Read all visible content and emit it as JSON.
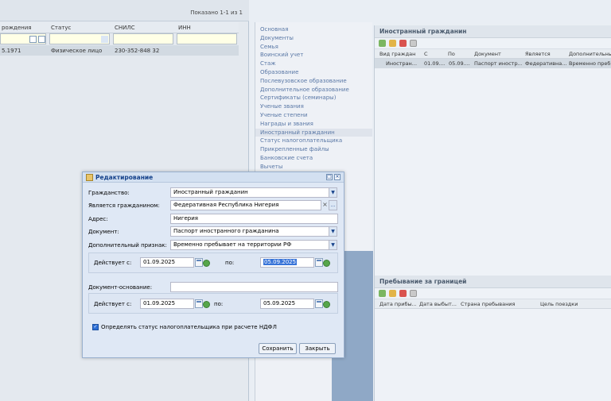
{
  "left_grid": {
    "paging": "Показано 1-1 из 1",
    "columns": [
      "рождения",
      "Статус",
      "СНИЛС",
      "ИНН"
    ],
    "row": [
      "5.1971",
      "Физическое лицо",
      "230-352-848 32",
      ""
    ]
  },
  "nav": {
    "items": [
      "Основная",
      "Документы",
      "Семья",
      "Воинский учет",
      "Стаж",
      "Образование",
      "Послевузовское образование",
      "Дополнительное образование",
      "Сертификаты (семинары)",
      "Ученые звания",
      "Ученые степени",
      "Награды и звания",
      "Иностранный гражданин",
      "Статус налогоплательщика",
      "Прикрепленные файлы",
      "Банковские счета",
      "Вычеты"
    ]
  },
  "foreign_panel": {
    "title": "Иностранный гражданин",
    "columns": [
      "Вид граждан...",
      "С",
      "По",
      "Документ",
      "Является",
      "Дополнительны..."
    ],
    "row": [
      "Иностран...",
      "01.09....",
      "05.09....",
      "Паспорт иностр...",
      "Федеративна...",
      "Временно пребы"
    ]
  },
  "abroad_panel": {
    "title": "Пребывание за границей",
    "columns": [
      "Дата прибы...",
      "Дата выбыт...",
      "Страна пребывания",
      "Цель поездки"
    ]
  },
  "dialog": {
    "title": "Редактирование",
    "citizenship_label": "Гражданство:",
    "citizenship_value": "Иностранный гражданин",
    "is_citizen_label": "Является гражданином:",
    "is_citizen_value": "Федеративная Республика Нигерия",
    "address_label": "Адрес:",
    "address_value": "Нигерия",
    "document_label": "Документ:",
    "document_value": "Паспорт иностранного гражданина",
    "extra_label": "Дополнительный признак:",
    "extra_value": "Временно пребывает на территории РФ",
    "valid_from_label": "Действует с:",
    "valid_from": "01.09.2025",
    "valid_to_label": "по:",
    "valid_to": "05.09.2025",
    "basis_label": "Документ-основание:",
    "basis_value": "",
    "basis_from_label": "Действует с:",
    "basis_from": "01.09.2025",
    "basis_to_label": "по:",
    "basis_to": "05.09.2025",
    "taxpayer_checkbox_label": "Определять статус налогоплательщика при расчете НДФЛ",
    "taxpayer_checked": true,
    "save_button": "Сохранить",
    "close_button": "Закрыть"
  }
}
